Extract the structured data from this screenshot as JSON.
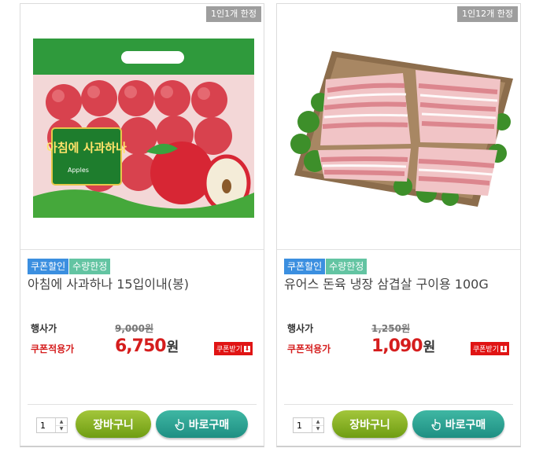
{
  "products": [
    {
      "limit_tag": "1인1개 한정",
      "badges": [
        "쿠폰할인",
        "수량한정"
      ],
      "name": "아침에 사과하나 15입이내(봉)",
      "regular_label": "행사가",
      "regular_price": "9,000원",
      "coupon_label": "쿠폰적용가",
      "sale_price": "6,750",
      "currency": "원",
      "coupon_button": "쿠폰받기",
      "quantity": "1",
      "cart_button": "장바구니",
      "buy_button": "바로구매",
      "image_icon": "apple-bag-image",
      "package_text": "아침에 사과하나",
      "package_sub": "Apples"
    },
    {
      "limit_tag": "1인12개 한정",
      "badges": [
        "쿠폰할인",
        "수량한정"
      ],
      "name": "유어스 돈육 냉장 삼겹살 구이용 100G",
      "regular_label": "행사가",
      "regular_price": "1,250원",
      "coupon_label": "쿠폰적용가",
      "sale_price": "1,090",
      "currency": "원",
      "coupon_button": "쿠폰받기",
      "quantity": "1",
      "cart_button": "장바구니",
      "buy_button": "바로구매",
      "image_icon": "pork-belly-tray-image"
    }
  ],
  "colors": {
    "badge_blue": "#3b8fe0",
    "badge_green": "#63c4a2",
    "price_red": "#d51d1d",
    "cart_green": "#7ca61c",
    "buy_teal": "#23978a"
  }
}
